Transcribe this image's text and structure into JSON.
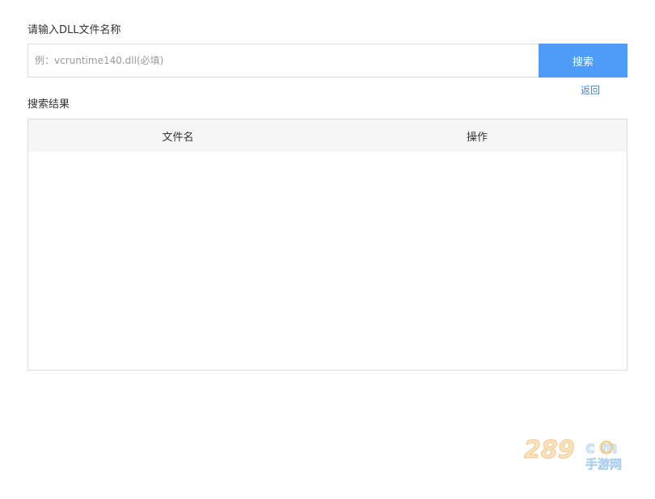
{
  "search": {
    "label": "请输入DLL文件名称",
    "placeholder": "例：vcruntime140.dll(必填)",
    "value": "",
    "button_label": "搜索"
  },
  "back_link": "返回",
  "results": {
    "label": "搜索结果",
    "columns": [
      "文件名",
      "操作"
    ],
    "rows": []
  },
  "watermark": {
    "text_top": "289",
    "text_com": "c m",
    "text_bottom": "手游网"
  },
  "colors": {
    "accent": "#4d9cf8",
    "link": "#3b86d6",
    "header_bg": "#f6f6f6",
    "border": "#dcdcdc"
  }
}
